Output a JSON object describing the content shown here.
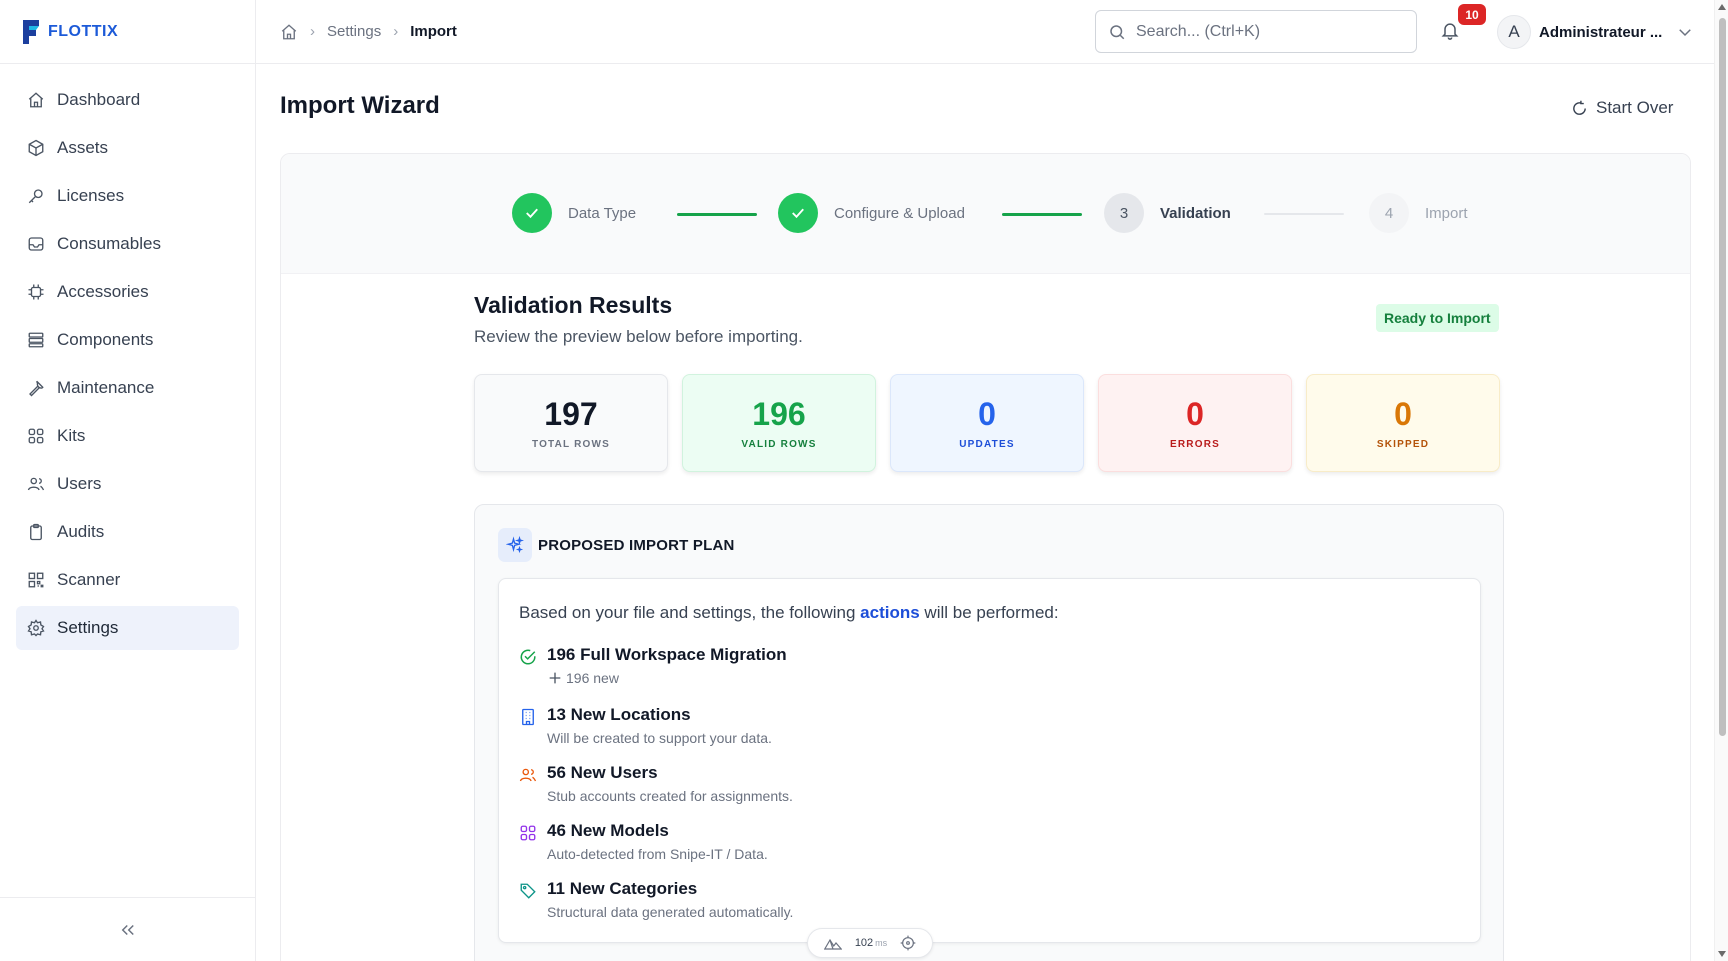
{
  "app": {
    "brand": "FLOTTIX"
  },
  "sidebar": {
    "items": [
      {
        "label": "Dashboard",
        "icon": "home-icon"
      },
      {
        "label": "Assets",
        "icon": "box-icon"
      },
      {
        "label": "Licenses",
        "icon": "key-icon"
      },
      {
        "label": "Consumables",
        "icon": "inbox-icon"
      },
      {
        "label": "Accessories",
        "icon": "cpu-icon"
      },
      {
        "label": "Components",
        "icon": "server-icon"
      },
      {
        "label": "Maintenance",
        "icon": "wrench-icon"
      },
      {
        "label": "Kits",
        "icon": "grid-icon"
      },
      {
        "label": "Users",
        "icon": "users-icon"
      },
      {
        "label": "Audits",
        "icon": "clipboard-icon"
      },
      {
        "label": "Scanner",
        "icon": "qr-icon"
      },
      {
        "label": "Settings",
        "icon": "gear-icon",
        "active": true
      }
    ]
  },
  "header": {
    "breadcrumb": {
      "settings": "Settings",
      "current": "Import"
    },
    "search_placeholder": "Search... (Ctrl+K)",
    "notifications_count": "10",
    "user": {
      "initial": "A",
      "name": "Administrateur ..."
    }
  },
  "page": {
    "title": "Import Wizard",
    "start_over": "Start Over"
  },
  "steps": [
    {
      "label": "Data Type",
      "state": "done"
    },
    {
      "label": "Configure & Upload",
      "state": "done"
    },
    {
      "number": "3",
      "label": "Validation",
      "state": "current"
    },
    {
      "number": "4",
      "label": "Import",
      "state": "todo"
    }
  ],
  "validation": {
    "title": "Validation Results",
    "subtitle": "Review the preview below before importing.",
    "status": "Ready to Import",
    "stats": [
      {
        "value": "197",
        "label": "TOTAL ROWS"
      },
      {
        "value": "196",
        "label": "VALID ROWS"
      },
      {
        "value": "0",
        "label": "UPDATES"
      },
      {
        "value": "0",
        "label": "ERRORS"
      },
      {
        "value": "0",
        "label": "SKIPPED"
      }
    ]
  },
  "plan": {
    "title": "PROPOSED IMPORT PLAN",
    "intro_before": "Based on your file and settings, the following ",
    "intro_highlight": "actions",
    "intro_after": " will be performed:",
    "items": [
      {
        "title": "196 Full Workspace Migration",
        "sub": "196 new",
        "icon": "check-circle-icon",
        "color": "#16a34a"
      },
      {
        "title": "13 New Locations",
        "sub": "Will be created to support your data.",
        "icon": "building-icon",
        "color": "#2563eb"
      },
      {
        "title": "56 New Users",
        "sub": "Stub accounts created for assignments.",
        "icon": "users-icon",
        "color": "#ea580c"
      },
      {
        "title": "46 New Models",
        "sub": "Auto-detected from Snipe-IT / Data.",
        "icon": "grid-icon",
        "color": "#9333ea"
      },
      {
        "title": "11 New Categories",
        "sub": "Structural data generated automatically.",
        "icon": "tag-icon",
        "color": "#0d9488"
      }
    ]
  },
  "perf": {
    "value": "102",
    "unit": "ms"
  }
}
